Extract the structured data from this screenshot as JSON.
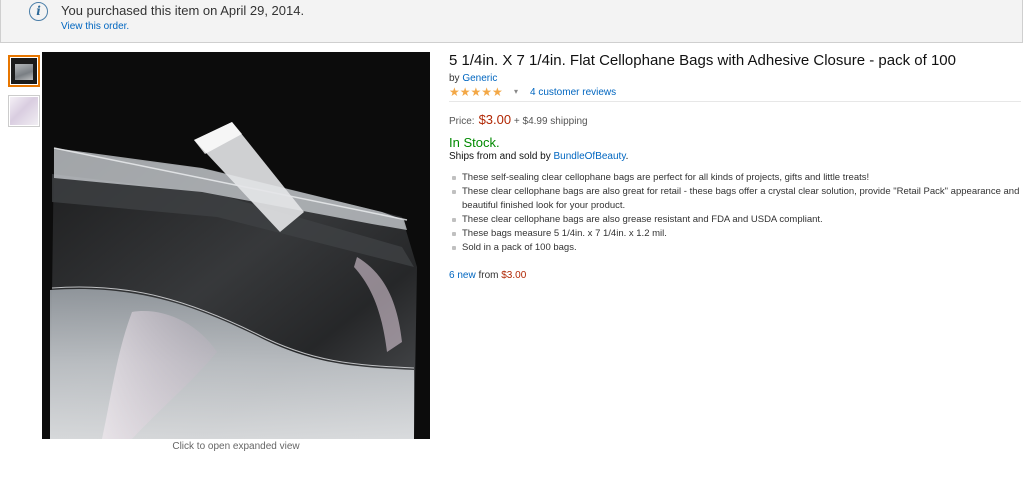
{
  "notice": {
    "icon": "info-icon",
    "message": "You purchased this item on April 29, 2014.",
    "link": "View this order."
  },
  "gallery": {
    "thumbnails": [
      "bag-photo-thumbnail",
      "bag-pink-thumbnail"
    ],
    "caption": "Click to open expanded view"
  },
  "product": {
    "title": "5 1/4in. X 7 1/4in. Flat Cellophane Bags with Adhesive Closure - pack of 100",
    "by_label": "by",
    "brand": "Generic",
    "stars": "★★★★★",
    "rating_caret": "▾",
    "reviews_link": "4 customer reviews",
    "price_label": "Price:",
    "price": "$3.00",
    "shipping": "+ $4.99 shipping",
    "stock": "In Stock.",
    "ships_text": "Ships from and sold by",
    "seller": "BundleOfBeauty",
    "ships_end": ".",
    "bullets": [
      "These self-sealing clear cellophane bags are perfect for all kinds of projects, gifts and little treats!",
      "These clear cellophane bags are also great for retail - these bags offer a crystal clear solution, provide \"Retail Pack\" appearance and beautiful finished look for your product.",
      "These clear cellophane bags are also grease resistant and FDA and USDA compliant.",
      "These bags measure 5 1/4in. x 7 1/4in. x 1.2 mil.",
      "Sold in a pack of 100 bags."
    ],
    "offers_new": "6 new",
    "offers_from": "from",
    "offers_price": "$3.00"
  },
  "colors": {
    "link": "#0066c0",
    "price": "#b12704",
    "stock": "#008a00",
    "star": "#f3a847",
    "selected_thumb_border": "#e77600"
  }
}
